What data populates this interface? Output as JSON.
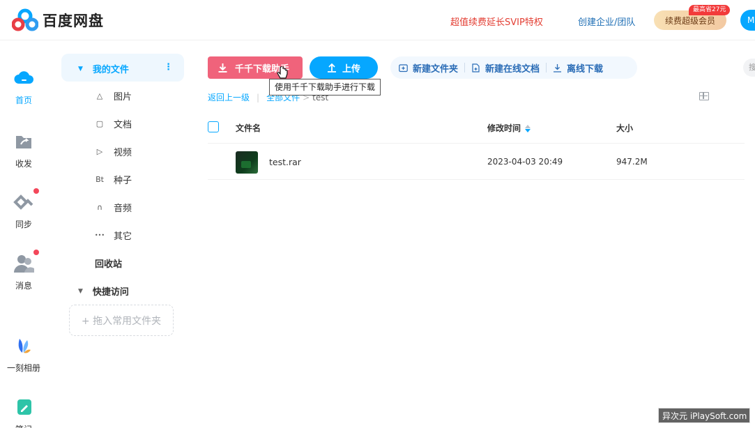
{
  "header": {
    "brand": "百度网盘",
    "promo_text": "超值续费延长SVIP特权",
    "enterprise_link": "创建企业/团队",
    "vip_button": "续费超级会员",
    "vip_badge": "最高省27元",
    "user_button_partial": "M"
  },
  "rail": [
    {
      "label": "首页",
      "icon": "cloud-home-icon",
      "active": true
    },
    {
      "label": "收发",
      "icon": "share-folder-icon",
      "active": false
    },
    {
      "label": "同步",
      "icon": "sync-icon",
      "active": false,
      "dot": true
    },
    {
      "label": "消息",
      "icon": "people-icon",
      "active": false,
      "dot": true
    },
    {
      "label": "一刻相册",
      "icon": "album-icon",
      "active": false
    },
    {
      "label": "笔记",
      "icon": "note-icon",
      "active": false
    }
  ],
  "sidebar": {
    "my_files": "我的文件",
    "categories": [
      {
        "label": "图片",
        "icon": "image-icon",
        "glyph": "△"
      },
      {
        "label": "文档",
        "icon": "document-icon",
        "glyph": "▢"
      },
      {
        "label": "视频",
        "icon": "video-icon",
        "glyph": "▷"
      },
      {
        "label": "种子",
        "icon": "torrent-icon",
        "glyph": "Bt"
      },
      {
        "label": "音频",
        "icon": "audio-icon",
        "glyph": "∩"
      },
      {
        "label": "其它",
        "icon": "more-icon",
        "glyph": "•••"
      }
    ],
    "recycle_bin": "回收站",
    "quick_access": "快捷访问",
    "drop_hint": "+ 拖入常用文件夹"
  },
  "toolbar": {
    "download_helper": "千千下载助手",
    "upload": "上传",
    "new_folder": "新建文件夹",
    "new_online_doc": "新建在线文档",
    "offline_download": "离线下载",
    "tooltip": "使用千千下载助手进行下载",
    "right_partial": "搜"
  },
  "breadcrumb": {
    "back": "返回上一级",
    "all_files": "全部文件",
    "current": "test"
  },
  "table": {
    "headers": {
      "name": "文件名",
      "modified": "修改时间",
      "size": "大小"
    },
    "rows": [
      {
        "name": "test.rar",
        "modified": "2023-04-03 20:49",
        "size": "947.2M"
      }
    ]
  },
  "watermark": "异次元 iPlaySoft.com",
  "colors": {
    "accent": "#06a7ff",
    "pink": "#f0637b",
    "promo_red": "#e33e33",
    "link_blue": "#1f6fb5"
  }
}
